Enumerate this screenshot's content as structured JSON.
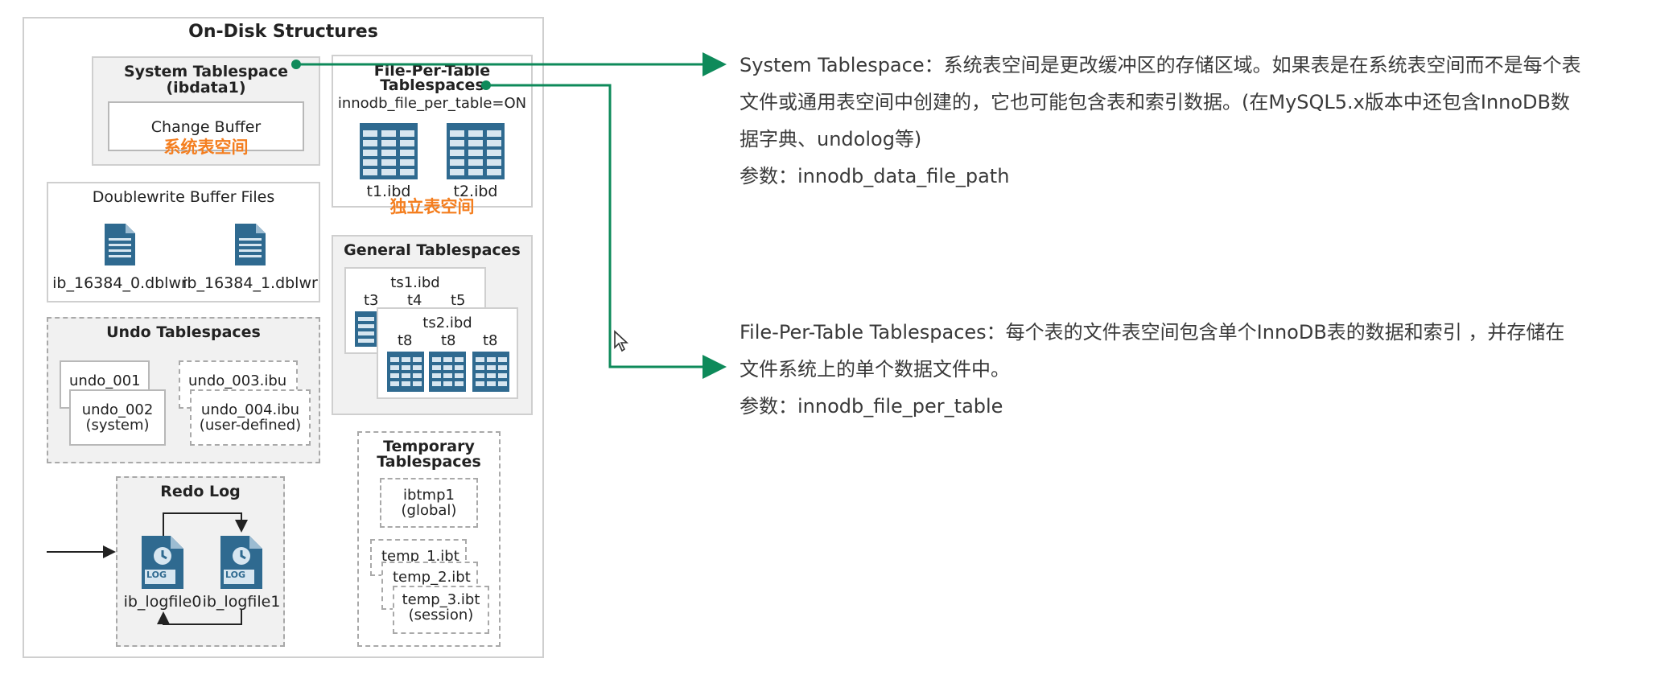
{
  "diagram": {
    "title": "On-Disk Structures",
    "system_tablespace": {
      "title_line1": "System Tablespace",
      "title_line2": "(ibdata1)",
      "change_buffer": "Change Buffer",
      "cn_label": "系统表空间"
    },
    "file_per_table": {
      "title_line1": "File-Per-Table",
      "title_line2": "Tablespaces",
      "setting": "innodb_file_per_table=ON",
      "file1": "t1.ibd",
      "file2": "t2.ibd",
      "cn_label": "独立表空间"
    },
    "doublewrite": {
      "title": "Doublewrite Buffer Files",
      "file1": "ib_16384_0.dblwr",
      "file2": "ib_16384_1.dblwr"
    },
    "general_tablespaces": {
      "title": "General Tablespaces",
      "ts1": "ts1.ibd",
      "ts1_tables": [
        "t3",
        "t4",
        "t5"
      ],
      "ts2": "ts2.ibd",
      "ts2_tables": [
        "t8",
        "t8",
        "t8"
      ]
    },
    "undo": {
      "title": "Undo Tablespaces",
      "undo1": "undo_001",
      "undo2_line1": "undo_002",
      "undo2_line2": "(system)",
      "undo3": "undo_003.ibu",
      "undo4_line1": "undo_004.ibu",
      "undo4_line2": "(user-defined)"
    },
    "temporary": {
      "title_line1": "Temporary",
      "title_line2": "Tablespaces",
      "ibtmp_line1": "ibtmp1",
      "ibtmp_line2": "(global)",
      "temp1": "temp_1.ibt",
      "temp2": "temp_2.ibt",
      "temp3_line1": "temp_3.ibt",
      "temp3_line2": "(session)"
    },
    "redo": {
      "title": "Redo Log",
      "file1": "ib_logfile0",
      "file2": "ib_logfile1",
      "log_tag": "LOG"
    }
  },
  "notes": {
    "system_tablespace": {
      "line1": "System Tablespace：系统表空间是更改缓冲区的存储区域。如果表是在系统表空间而不是每个表",
      "line2": "文件或通用表空间中创建的，它也可能包含表和索引数据。(在MySQL5.x版本中还包含InnoDB数",
      "line3": "据字典、undolog等)",
      "param": "参数：innodb_data_file_path"
    },
    "file_per_table": {
      "line1": "File-Per-Table Tablespaces：每个表的文件表空间包含单个InnoDB表的数据和索引 ，并存储在",
      "line2": "文件系统上的单个数据文件中。",
      "param": "参数：innodb_file_per_table"
    }
  },
  "colors": {
    "connector": "#0e8a5a",
    "orange_label": "#f47e1f",
    "table_icon": "#2f6a90",
    "table_icon_light": "#d7e6f0",
    "panel_bg": "#f1f1f1"
  }
}
